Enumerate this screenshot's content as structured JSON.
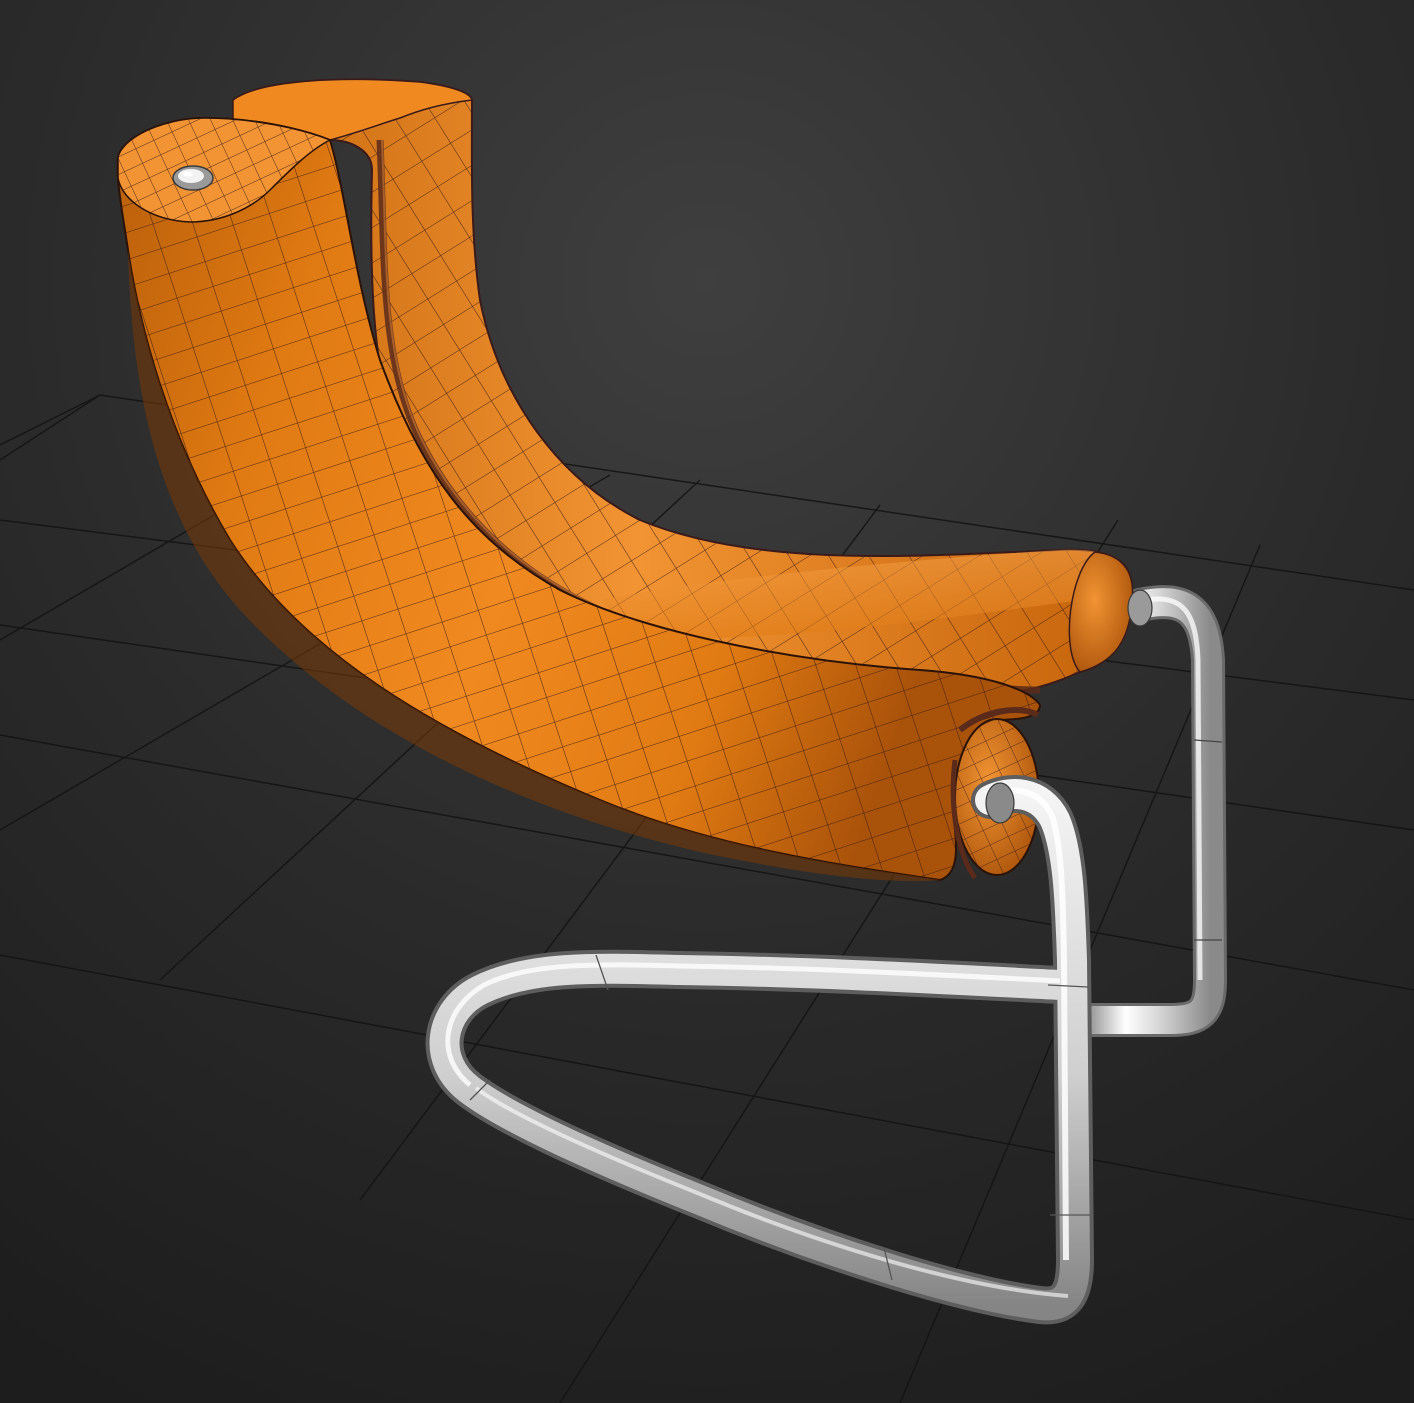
{
  "viewport": {
    "render_mode": "shaded-with-edged-faces",
    "view": "perspective"
  },
  "scene": {
    "background_gradient": [
      "#3f3f3f",
      "#2a2a2a",
      "#1d1d1d"
    ],
    "grid_color": "#141414",
    "object": "lounge-chair",
    "cushion": {
      "material_color": "#e07a12",
      "highlight_color": "#f4a043",
      "shadow_color": "#8a4205",
      "wire_color": "#3a1a1a"
    },
    "frame": {
      "material_color": "#d8d8d8",
      "highlight_color": "#ffffff",
      "shadow_color": "#7a7a7a"
    }
  }
}
